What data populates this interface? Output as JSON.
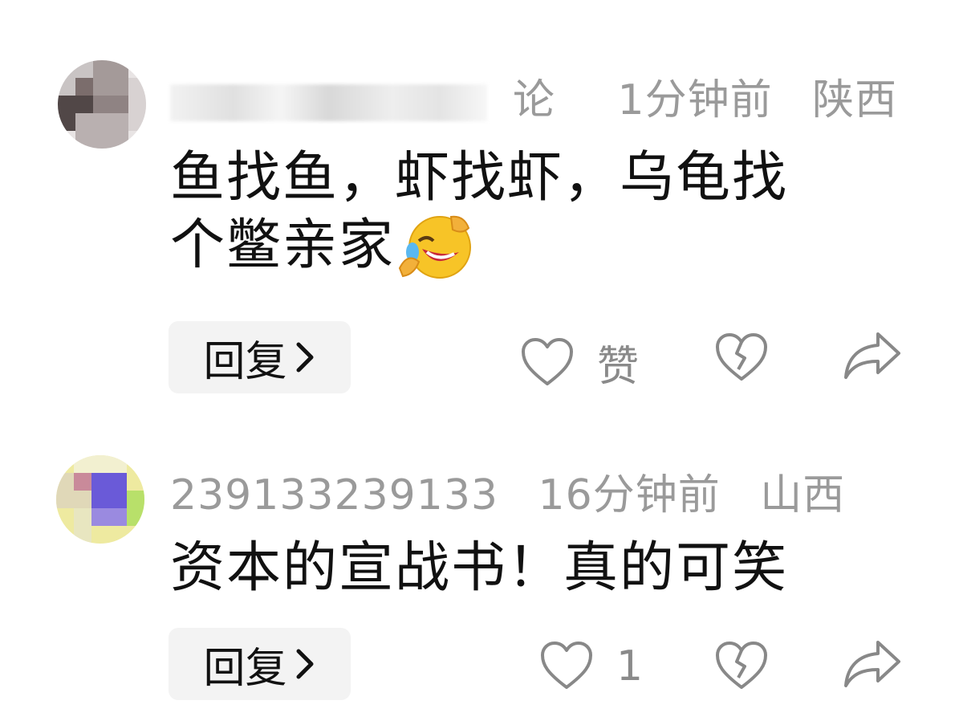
{
  "comments": [
    {
      "username_visible_tail": "论",
      "time": "1分钟前",
      "location": "陕西",
      "text_line1": "鱼找鱼，虾找虾，乌龟找",
      "text_line2": "个鳖亲家",
      "emoji": "rofl-emoji",
      "reply_label": "回复",
      "like_label": "赞",
      "icons": [
        "heart-icon",
        "broken-heart-icon",
        "share-icon"
      ]
    },
    {
      "username": "239133239133",
      "time": "16分钟前",
      "location": "山西",
      "text_line1": "资本的宣战书！真的可笑",
      "reply_label": "回复",
      "like_count": "1",
      "icons": [
        "heart-icon",
        "broken-heart-icon",
        "share-icon"
      ]
    }
  ]
}
